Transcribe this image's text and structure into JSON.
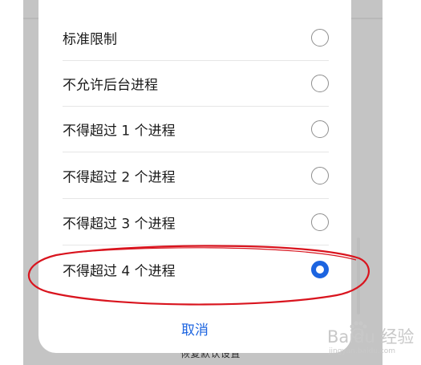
{
  "dialog": {
    "options": [
      {
        "label": "标准限制",
        "selected": false
      },
      {
        "label": "不允许后台进程",
        "selected": false
      },
      {
        "label": "不得超过 1 个进程",
        "selected": false
      },
      {
        "label": "不得超过 2 个进程",
        "selected": false
      },
      {
        "label": "不得超过 3 个进程",
        "selected": false
      },
      {
        "label": "不得超过 4 个进程",
        "selected": true
      }
    ],
    "cancel_label": "取消"
  },
  "background": {
    "behind_text": "恢复默认设置"
  },
  "watermark": {
    "main": "Baidu 经验",
    "sub": "jingyan.baidu.com"
  },
  "colors": {
    "accent": "#1c64e0",
    "highlight": "#d9141e",
    "backdrop": "#c4c4c4"
  }
}
